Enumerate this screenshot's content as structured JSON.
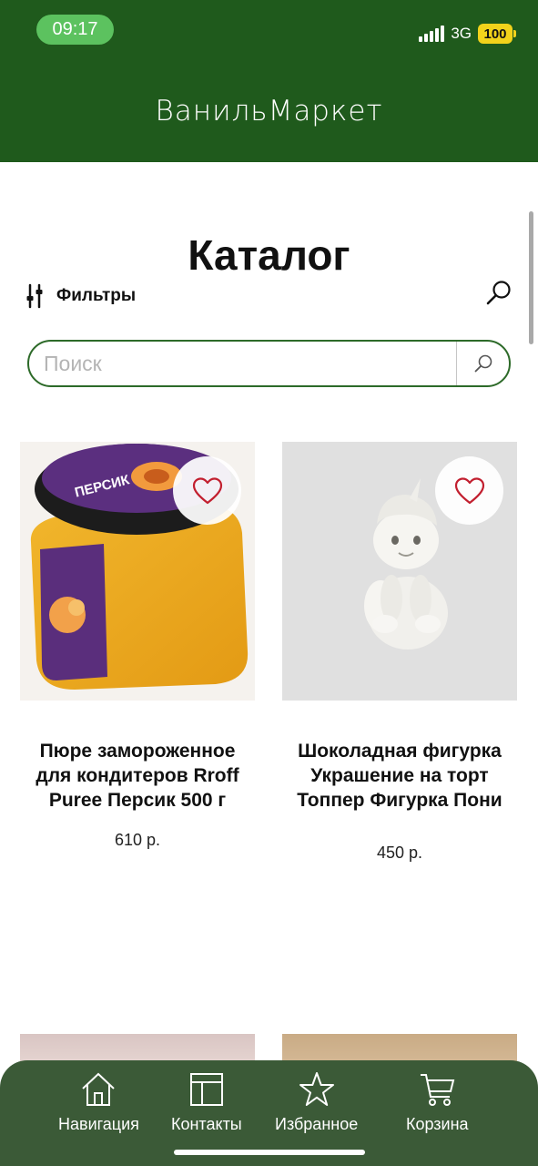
{
  "status_bar": {
    "time": "09:17",
    "network": "3G",
    "battery": "100"
  },
  "header": {
    "brand": "ВанильМаркет"
  },
  "catalog": {
    "title": "Каталог",
    "filters_label": "Фильтры",
    "search_placeholder": "Поиск"
  },
  "products": [
    {
      "name": "Пюре замороженное для кондитеров Rroff Puree Персик 500 г",
      "price": "610 р.",
      "image": "peach-puree-jar",
      "favorite": false
    },
    {
      "name": "Шоколадная фигурка Украшение на торт Топпер Фигурка Пони",
      "price": "450 р.",
      "image": "white-chocolate-pony-figure",
      "favorite": false
    }
  ],
  "bottom_nav": [
    {
      "label": "Навигация",
      "icon": "home-icon"
    },
    {
      "label": "Контакты",
      "icon": "contacts-icon"
    },
    {
      "label": "Избранное",
      "icon": "star-icon"
    },
    {
      "label": "Корзина",
      "icon": "cart-icon"
    }
  ],
  "colors": {
    "header_bg": "#1f5a1c",
    "accent": "#2d6a29",
    "nav_bg": "#3b5a37",
    "heart": "#c21f2f",
    "battery": "#f2d21b",
    "time_pill": "#5cc25f"
  }
}
